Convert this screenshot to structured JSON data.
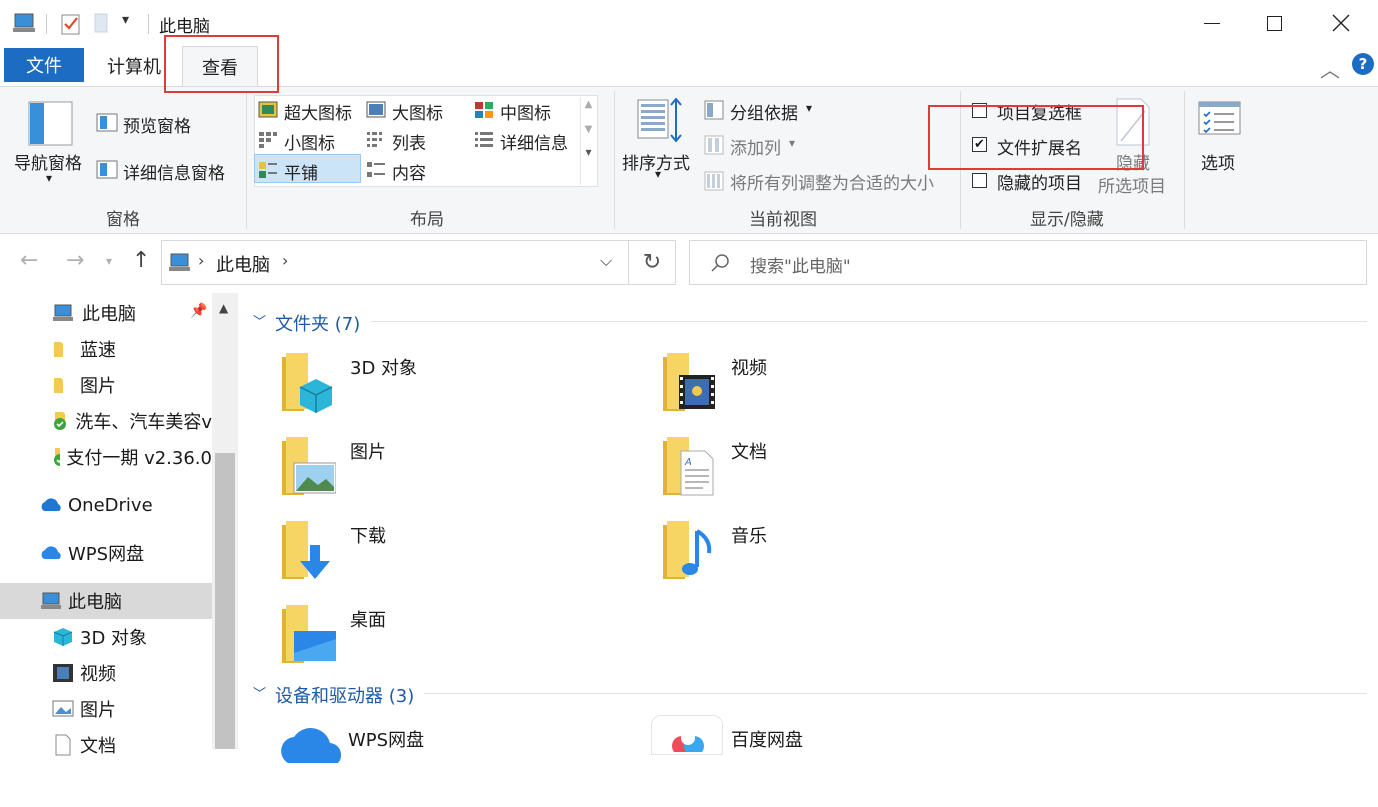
{
  "window": {
    "title": "此电脑",
    "qat_icons": [
      "computer-icon",
      "properties-icon",
      "new-folder-icon",
      "qat-dropdown-icon"
    ]
  },
  "tabs": {
    "file": "文件",
    "computer": "计算机",
    "view": "查看"
  },
  "ribbon": {
    "panes": {
      "title": "窗格",
      "nav_pane": "导航窗格",
      "preview_pane": "预览窗格",
      "details_pane": "详细信息窗格"
    },
    "layout": {
      "title": "布局",
      "options": [
        [
          "超大图标",
          "大图标",
          "中图标"
        ],
        [
          "小图标",
          "列表",
          "详细信息"
        ],
        [
          "平铺",
          "内容"
        ]
      ],
      "selected": "平铺"
    },
    "current_view": {
      "title": "当前视图",
      "sort_by": "排序方式",
      "group_by": "分组依据",
      "add_column": "添加列",
      "size_all_columns": "将所有列调整为合适的大小"
    },
    "show_hide": {
      "title": "显示/隐藏",
      "item_checkboxes": {
        "label": "项目复选框",
        "checked": false
      },
      "file_extensions": {
        "label": "文件扩展名",
        "checked": true
      },
      "hidden_items": {
        "label": "隐藏的项目",
        "checked": false
      },
      "hide_selected_line1": "隐藏",
      "hide_selected_line2": "所选项目"
    },
    "options": "选项"
  },
  "address": {
    "crumb": "此电脑",
    "search_placeholder": "搜索\"此电脑\""
  },
  "nav": {
    "items": [
      {
        "label": "此电脑",
        "icon": "computer-icon"
      },
      {
        "label": "蓝速",
        "icon": "folder-icon"
      },
      {
        "label": "图片",
        "icon": "folder-icon"
      },
      {
        "label": "洗车、汽车美容v",
        "icon": "synced-folder-icon"
      },
      {
        "label": "支付一期 v2.36.0",
        "icon": "synced-folder-icon"
      },
      {
        "label": "OneDrive",
        "icon": "onedrive-icon"
      },
      {
        "label": "WPS网盘",
        "icon": "wps-cloud-icon"
      },
      {
        "label": "此电脑",
        "icon": "computer-icon"
      },
      {
        "label": "3D 对象",
        "icon": "3d-objects-icon"
      },
      {
        "label": "视频",
        "icon": "video-icon"
      },
      {
        "label": "图片",
        "icon": "pictures-icon"
      },
      {
        "label": "文档",
        "icon": "documents-icon"
      }
    ],
    "selected_index": 7
  },
  "content": {
    "folders_header": "文件夹 (7)",
    "folders": [
      {
        "name": "3D 对象",
        "icon": "3d-objects-icon"
      },
      {
        "name": "视频",
        "icon": "video-icon"
      },
      {
        "name": "图片",
        "icon": "pictures-icon"
      },
      {
        "name": "文档",
        "icon": "documents-icon"
      },
      {
        "name": "下载",
        "icon": "downloads-icon"
      },
      {
        "name": "音乐",
        "icon": "music-icon"
      },
      {
        "name": "桌面",
        "icon": "desktop-icon"
      }
    ],
    "devices_header": "设备和驱动器 (3)",
    "devices": [
      {
        "name": "WPS网盘",
        "icon": "wps-cloud-icon"
      },
      {
        "name": "百度网盘",
        "icon": "baidu-netdisk-icon"
      }
    ]
  },
  "colors": {
    "accent": "#1c6cc4",
    "annotation": "#e03a3a",
    "folder": "#f3c94f"
  }
}
